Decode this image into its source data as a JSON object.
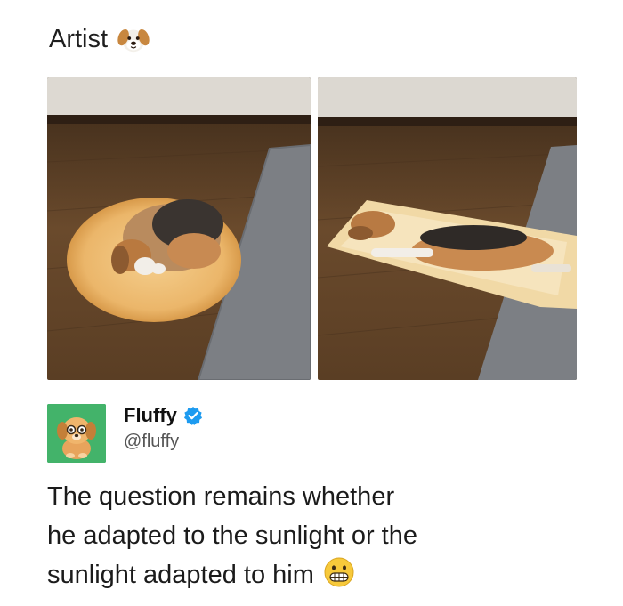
{
  "post": {
    "title": "Artist",
    "title_icon": "dog-face-emoji"
  },
  "photos": [
    {
      "name": "beagle-curled-in-sun-circle-photo",
      "icon": "photo"
    },
    {
      "name": "beagle-stretched-in-sun-rectangle-photo",
      "icon": "photo"
    }
  ],
  "tweet": {
    "avatar_icon": "cartoon-dog-avatar",
    "display_name": "Fluffy",
    "verified_icon": "verified-badge-icon",
    "handle": "@fluffy",
    "lines": [
      "The question remains whether",
      "he adapted to the sunlight or the",
      "sunlight adapted to him"
    ],
    "end_emoji": "grimacing-face-emoji"
  },
  "colors": {
    "avatar_bg": "#43b36a",
    "verified": "#1d9bf0",
    "floor": "#6b4a2b",
    "rug": "#7c7f84"
  }
}
